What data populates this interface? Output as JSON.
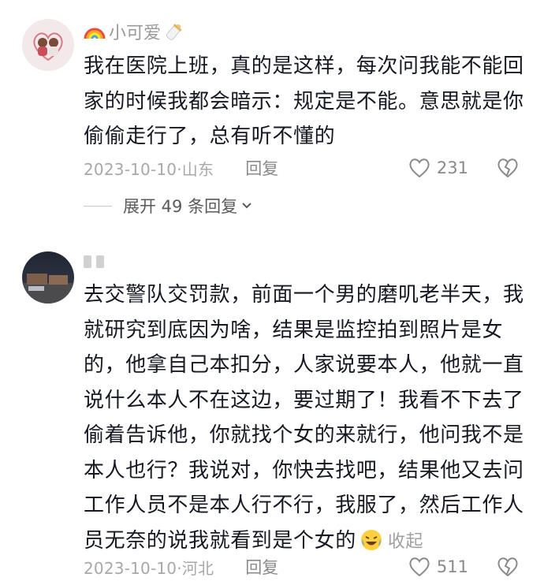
{
  "comments": [
    {
      "username": "小可爱",
      "text": "我在医院上班，真的是这样，每次问我能不能回家的时候我都会暗示：规定是不能。意思就是你偷偷走行了，总有听不懂的",
      "date": "2023-10-10",
      "location": "山东",
      "reply_label": "回复",
      "likes": "231",
      "expand_label": "展开 49 条回复",
      "icons": [
        "rainbow-icon",
        "baby-bottle-icon",
        "heart-icon",
        "broken-heart-icon",
        "chevron-down-icon"
      ]
    },
    {
      "username": "",
      "text": "去交警队交罚款，前面一个男的磨叽老半天，我就研究到底因为啥，结果是监控拍到照片是女的，他拿自己本扣分，人家说要本人，他就一直说什么本人不在这边，要过期了！我看不下去了偷着告诉他，你就找个女的来就行，他问我不是本人也行？我说对，你快去找吧，结果他又去问工作人员不是本人行不行，我服了，然后工作人员无奈的说我就看到是个女的",
      "collapse_label": "收起",
      "date": "2023-10-10",
      "location": "河北",
      "reply_label": "回复",
      "likes": "511",
      "icons": [
        "crying-laughing-emoji",
        "heart-icon",
        "broken-heart-icon"
      ]
    }
  ],
  "colors": {
    "text": "#161823",
    "meta": "#a8a8a8",
    "rainbow_red": "#e94b3c"
  }
}
